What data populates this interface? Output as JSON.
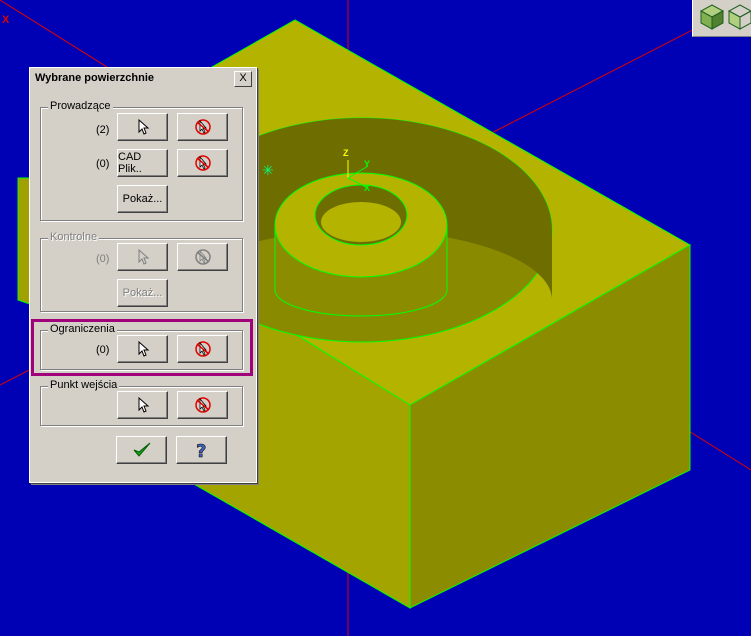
{
  "viewport": {
    "background_color": "#0000b4",
    "part_color": "#b4b400",
    "axis_labels": {
      "x": "X",
      "z": "Z",
      "y": "Y",
      "x2": "X"
    }
  },
  "view_icons": [
    "isometric-cube-icon",
    "wireframe-cube-icon"
  ],
  "dialog": {
    "title": "Wybrane powierzchnie",
    "close_label": "X",
    "groups": {
      "prowadzace": {
        "label": "Prowadzące",
        "row1_count": "(2)",
        "row2_count": "(0)",
        "cad_button": "CAD Plik..",
        "show_button": "Pokaż..."
      },
      "kontrolne": {
        "label": "Kontrolne",
        "count": "(0)",
        "show_button": "Pokaż..."
      },
      "ograniczenia": {
        "label": "Ograniczenia",
        "count": "(0)"
      },
      "punkt_wejscia": {
        "label": "Punkt wejścia"
      }
    },
    "ok_icon": "checkmark-icon",
    "help_icon": "question-mark-icon",
    "highlight_color": "#a0007a"
  }
}
